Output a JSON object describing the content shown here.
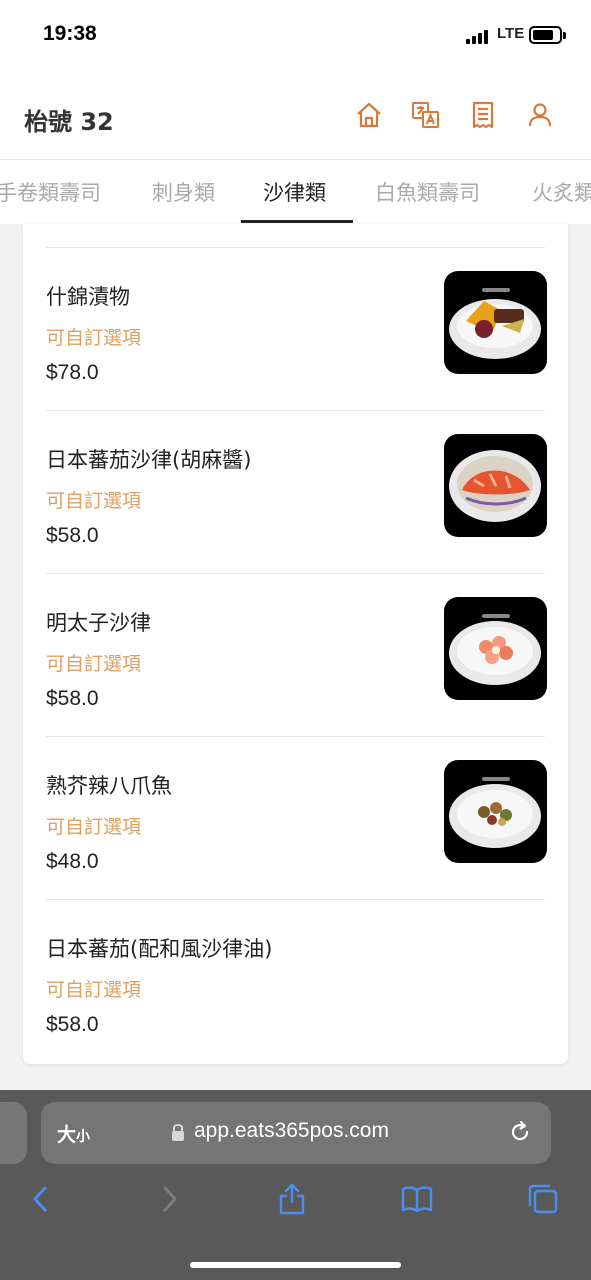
{
  "status_bar": {
    "time": "19:38",
    "network": "LTE"
  },
  "header": {
    "title": "枱號 32",
    "icons": [
      "home-icon",
      "translate-icon",
      "receipt-icon",
      "user-icon"
    ],
    "accent_color": "#d9783a"
  },
  "tabs": [
    {
      "label": "手卷類壽司",
      "active": false
    },
    {
      "label": "刺身類",
      "active": false
    },
    {
      "label": "沙律類",
      "active": true
    },
    {
      "label": "白魚類壽司",
      "active": false
    },
    {
      "label": "火炙類",
      "active": false
    }
  ],
  "menu_items": [
    {
      "name": "什錦漬物",
      "option": "可自訂選項",
      "price": "$78.0",
      "has_image": true
    },
    {
      "name": "日本蕃茄沙律(胡麻醬)",
      "option": "可自訂選項",
      "price": "$58.0",
      "has_image": true
    },
    {
      "name": "明太子沙律",
      "option": "可自訂選項",
      "price": "$58.0",
      "has_image": true
    },
    {
      "name": "熟芥辣八爪魚",
      "option": "可自訂選項",
      "price": "$48.0",
      "has_image": true
    },
    {
      "name": "日本蕃茄(配和風沙律油)",
      "option": "可自訂選項",
      "price": "$58.0",
      "has_image": false
    }
  ],
  "browser": {
    "text_size_label": "大",
    "text_size_small": "小",
    "url": "app.eats365pos.com",
    "accent_color": "#3b82f6"
  }
}
